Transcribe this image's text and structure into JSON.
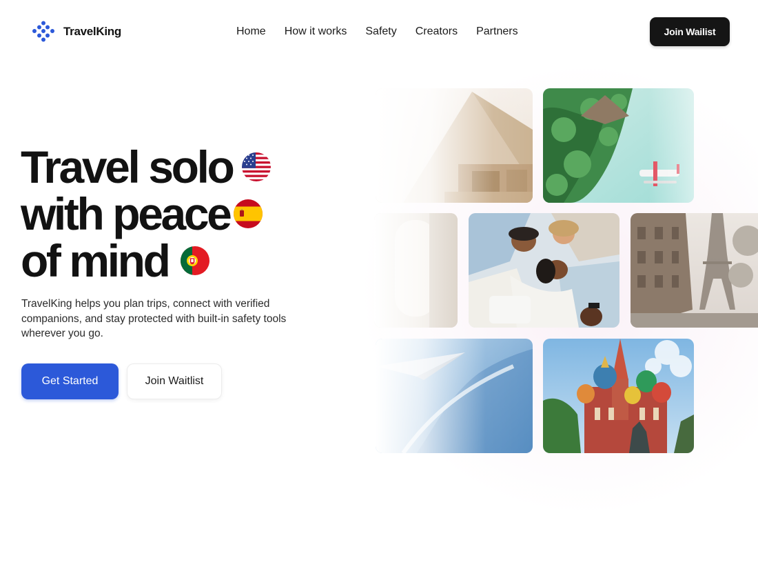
{
  "brand": {
    "name": "TravelKing",
    "accent": "#2c59d9"
  },
  "nav": {
    "items": [
      {
        "label": "Home"
      },
      {
        "label": "How it works"
      },
      {
        "label": "Safety"
      },
      {
        "label": "Creators"
      },
      {
        "label": "Partners"
      }
    ],
    "cta": "Join Wailist"
  },
  "hero": {
    "lines": [
      "Travel solo",
      "with peace",
      "of mind"
    ],
    "flags": [
      "us-flag-icon",
      "spain-flag-icon",
      "portugal-flag-icon"
    ],
    "description": "TravelKing helps you plan trips, connect with verified companions, and stay protected with built-in safety tools wherever you go.",
    "primary_button": "Get Started",
    "secondary_button": "Join Waitlist"
  },
  "gallery": {
    "images": [
      "pyramids-photo",
      "tropical-island-seaplane-photo",
      "airplane-window-photo",
      "friends-lying-in-circle-photo",
      "paris-eiffel-tower-photo",
      "aerial-coastline-from-plane-photo",
      "st-basils-cathedral-moscow-photo"
    ]
  }
}
